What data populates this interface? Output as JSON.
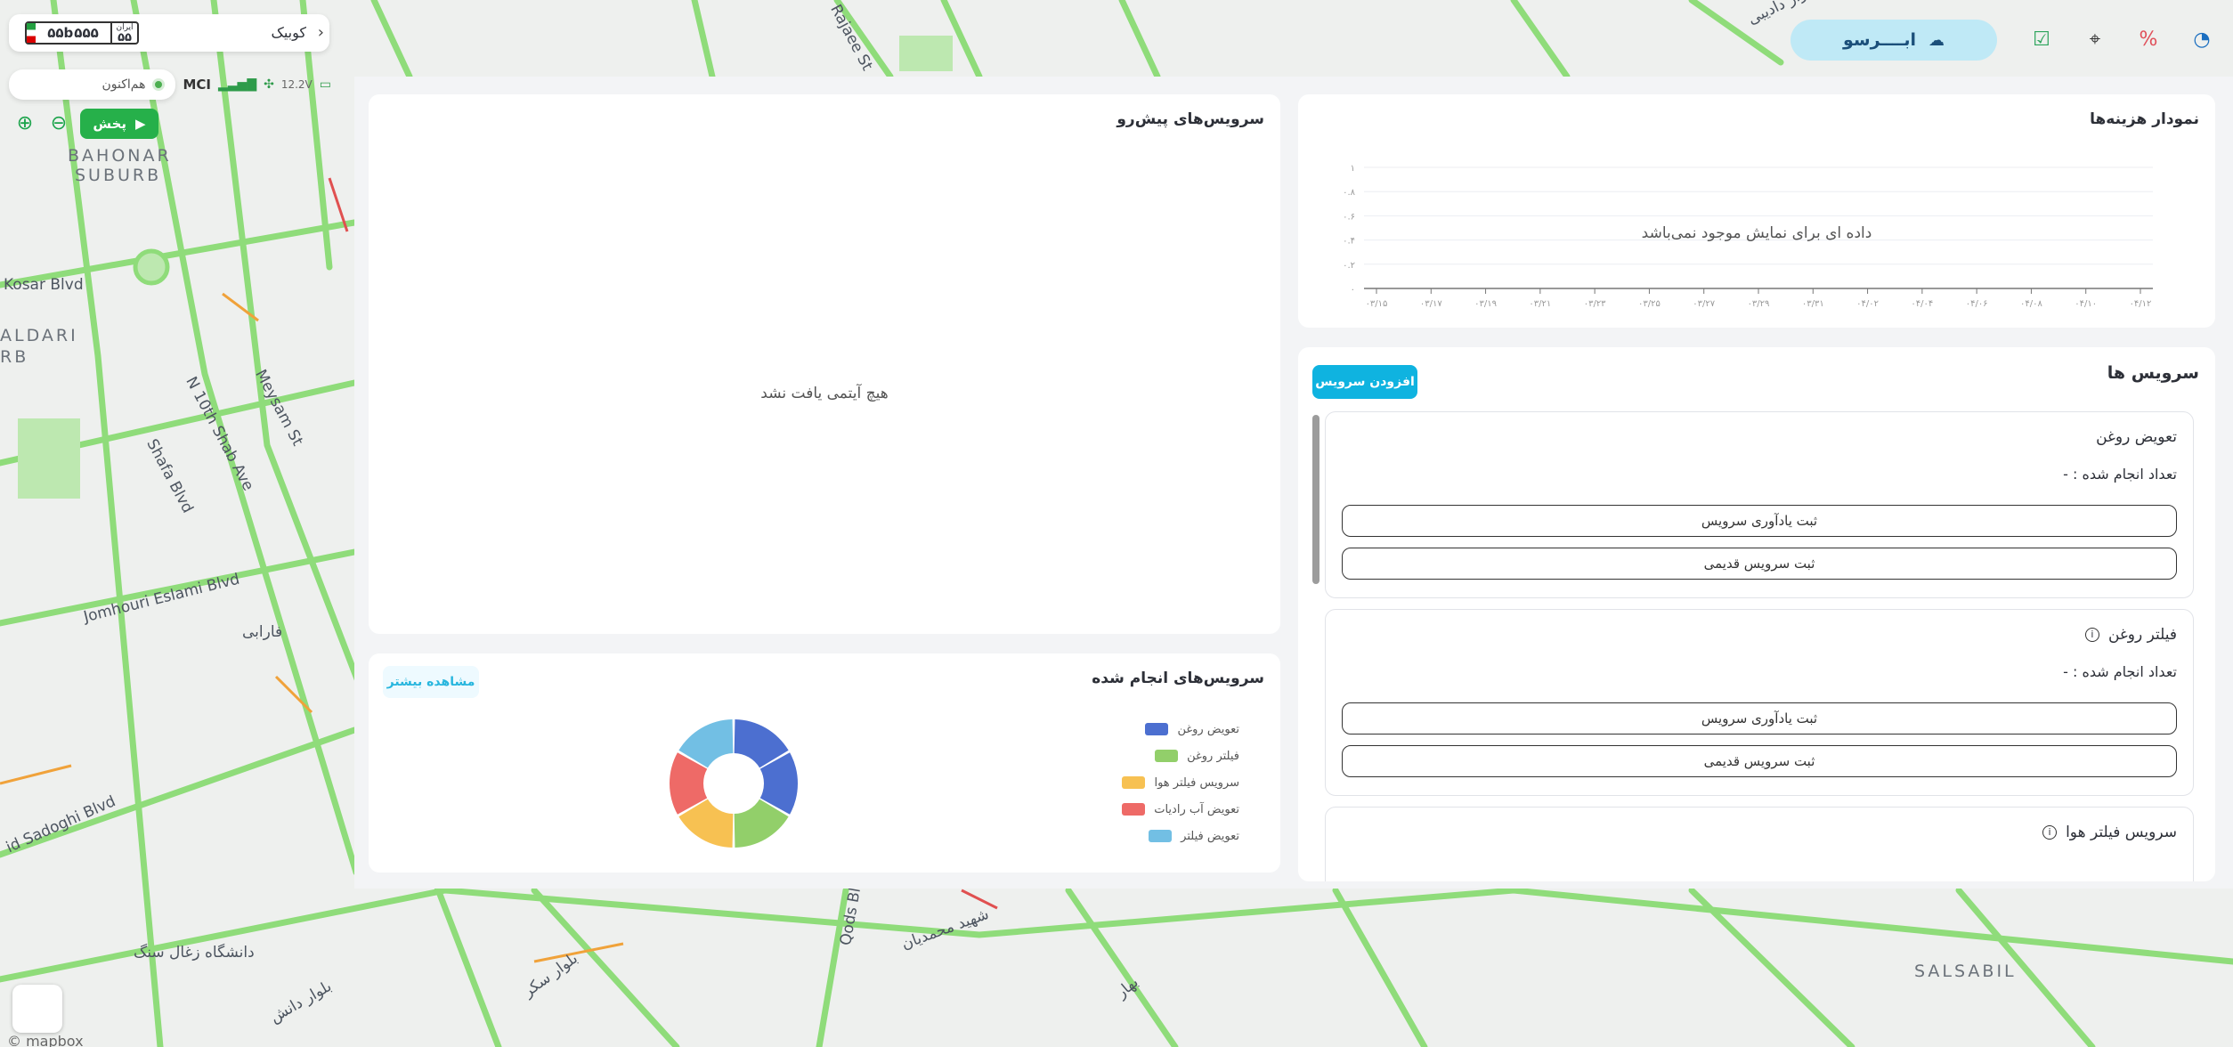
{
  "map": {
    "labels": {
      "bahonar": "BAHONAR",
      "suburb": "SUBURB",
      "kosar": "Kosar Blvd",
      "aldari": "ALDARI",
      "rb": "RB",
      "n10": "N 10th Shab Ave",
      "meysam": "Meysam St",
      "shafa": "Shafa Blvd",
      "jomhouri": "Jomhouri Eslami Blvd",
      "farabi": "فارابی",
      "sadoghi": "id Sadoghi Blvd",
      "uni": "دانشگاه زغال سنگ",
      "dunes": "بلوار دانش",
      "salsabil": "SALSABIL",
      "qods": "Qods Blvd",
      "rajaee": "Rajaee St",
      "mahmodian": "شهید محمدیان",
      "sarv": "بلوار سکر",
      "bahar": "بهار",
      "nadavan": "بلوار دادیبی"
    },
    "mapbox": "© mapbox"
  },
  "vehicle": {
    "plate_number": "۵۵b۵۵۵",
    "plate_region": "۵۵",
    "plate_region_label": "ایران",
    "name": "کوبیک",
    "voltage": "12.2V",
    "operator": "MCI",
    "live_label": "هم‌اکنون"
  },
  "controls": {
    "play_label": "پخش"
  },
  "toolbar": {
    "cloud_label": "ابــــرسو"
  },
  "cost_chart": {
    "title": "نمودار هزینه‌ها",
    "empty": "داده ای برای نمایش موجود نمی‌باشد"
  },
  "chart_data": {
    "type": "line",
    "title": "نمودار هزینه‌ها",
    "categories": [
      "۰۳/۱۵",
      "۰۳/۱۷",
      "۰۳/۱۹",
      "۰۳/۲۱",
      "۰۳/۲۳",
      "۰۳/۲۵",
      "۰۳/۲۷",
      "۰۳/۲۹",
      "۰۳/۳۱",
      "۰۴/۰۲",
      "۰۴/۰۴",
      "۰۴/۰۶",
      "۰۴/۰۸",
      "۰۴/۱۰",
      "۰۴/۱۲"
    ],
    "yticks": [
      "۰",
      "۰.۲",
      "۰.۴",
      "۰.۶",
      "۰.۸",
      "۱"
    ],
    "ylim": [
      0,
      1
    ],
    "series": []
  },
  "services": {
    "title": "سرویس ها",
    "add_label": "افزودن سرویس",
    "items": [
      {
        "name": "تعویض روغن",
        "count": "تعداد انجام شده : -",
        "remind": "ثبت یادآوری سرویس",
        "old": "ثبت سرویس قدیمی"
      },
      {
        "name": "فیلتر روغن",
        "count": "تعداد انجام شده : -",
        "remind": "ثبت یادآوری سرویس",
        "old": "ثبت سرویس قدیمی"
      },
      {
        "name": "سرویس فیلتر هوا",
        "count": "",
        "remind": "",
        "old": ""
      }
    ]
  },
  "upcoming": {
    "title": "سرویس‌های پیش‌رو",
    "empty": "هیچ آیتمی یافت نشد"
  },
  "done": {
    "title": "سرویس‌های انجام شده",
    "more_label": "مشاهده بیشتر",
    "legend": [
      {
        "label": "تعویض روغن",
        "color": "#4c6fd0"
      },
      {
        "label": "فیلتر روغن",
        "color": "#92cf6a"
      },
      {
        "label": "سرویس فیلتر هوا",
        "color": "#f7c152"
      },
      {
        "label": "تعویض آب رادیات",
        "color": "#ee6a67"
      },
      {
        "label": "تعویض فیلتر",
        "color": "#72bfe4"
      }
    ],
    "donut": [
      {
        "color": "#4c6fd0",
        "value": 1
      },
      {
        "color": "#4c6fd0",
        "value": 1
      },
      {
        "color": "#92cf6a",
        "value": 1
      },
      {
        "color": "#f7c152",
        "value": 1
      },
      {
        "color": "#ee6a67",
        "value": 1
      },
      {
        "color": "#72bfe4",
        "value": 1
      }
    ]
  }
}
